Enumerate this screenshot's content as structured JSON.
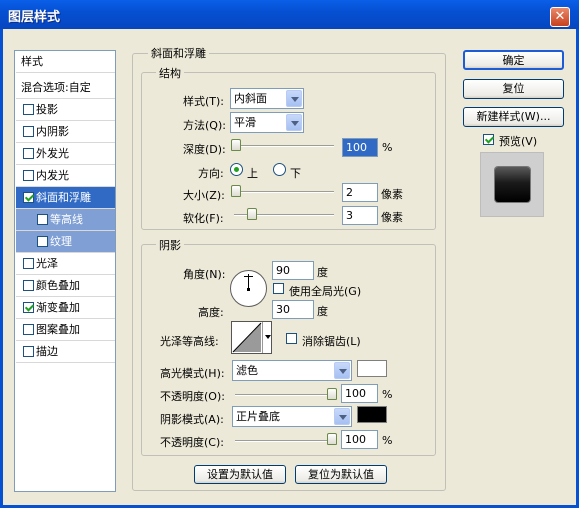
{
  "window": {
    "title": "图层样式",
    "close_glyph": "✕"
  },
  "left_list": {
    "header": "样式",
    "blend_options": "混合选项:自定",
    "items": [
      {
        "label": "投影",
        "checked": false
      },
      {
        "label": "内阴影",
        "checked": false
      },
      {
        "label": "外发光",
        "checked": false
      },
      {
        "label": "内发光",
        "checked": false
      },
      {
        "label": "斜面和浮雕",
        "checked": true,
        "selected": true
      },
      {
        "label": "等高线",
        "checked": false,
        "sub": true
      },
      {
        "label": "纹理",
        "checked": false,
        "sub": true
      },
      {
        "label": "光泽",
        "checked": false
      },
      {
        "label": "颜色叠加",
        "checked": false
      },
      {
        "label": "渐变叠加",
        "checked": true
      },
      {
        "label": "图案叠加",
        "checked": false
      },
      {
        "label": "描边",
        "checked": false
      }
    ]
  },
  "bevel": {
    "title": "斜面和浮雕",
    "structure": {
      "title": "结构",
      "style_label": "样式(T):",
      "style_value": "内斜面",
      "technique_label": "方法(Q):",
      "technique_value": "平滑",
      "depth_label": "深度(D):",
      "depth_value": "100",
      "depth_unit": "%",
      "depth_level": 0.02,
      "direction_label": "方向:",
      "dir_up": "上",
      "dir_down": "下",
      "direction": "up",
      "size_label": "大小(Z):",
      "size_value": "2",
      "size_unit": "像素",
      "size_level": 0.02,
      "soften_label": "软化(F):",
      "soften_value": "3",
      "soften_unit": "像素",
      "soften_level": 0.18
    },
    "shading": {
      "title": "阴影",
      "angle_label": "角度(N):",
      "angle_value": "90",
      "angle_unit": "度",
      "global_light_label": "使用全局光(G)",
      "global_light": false,
      "altitude_label": "高度:",
      "altitude_value": "30",
      "altitude_unit": "度",
      "gloss_label": "光泽等高线:",
      "antialias_label": "消除锯齿(L)",
      "antialias": false,
      "highlight_mode_label": "高光模式(H):",
      "highlight_mode_value": "滤色",
      "highlight_color": "#ffffff",
      "highlight_opacity_label": "不透明度(O):",
      "highlight_opacity_value": "100",
      "highlight_opacity_unit": "%",
      "shadow_mode_label": "阴影模式(A):",
      "shadow_mode_value": "正片叠底",
      "shadow_color": "#000000",
      "shadow_opacity_label": "不透明度(C):",
      "shadow_opacity_value": "100",
      "shadow_opacity_unit": "%"
    },
    "set_default": "设置为默认值",
    "reset_default": "复位为默认值"
  },
  "right": {
    "ok": "确定",
    "reset": "复位",
    "new_style": "新建样式(W)...",
    "preview_label": "预览(V)",
    "preview": true
  }
}
